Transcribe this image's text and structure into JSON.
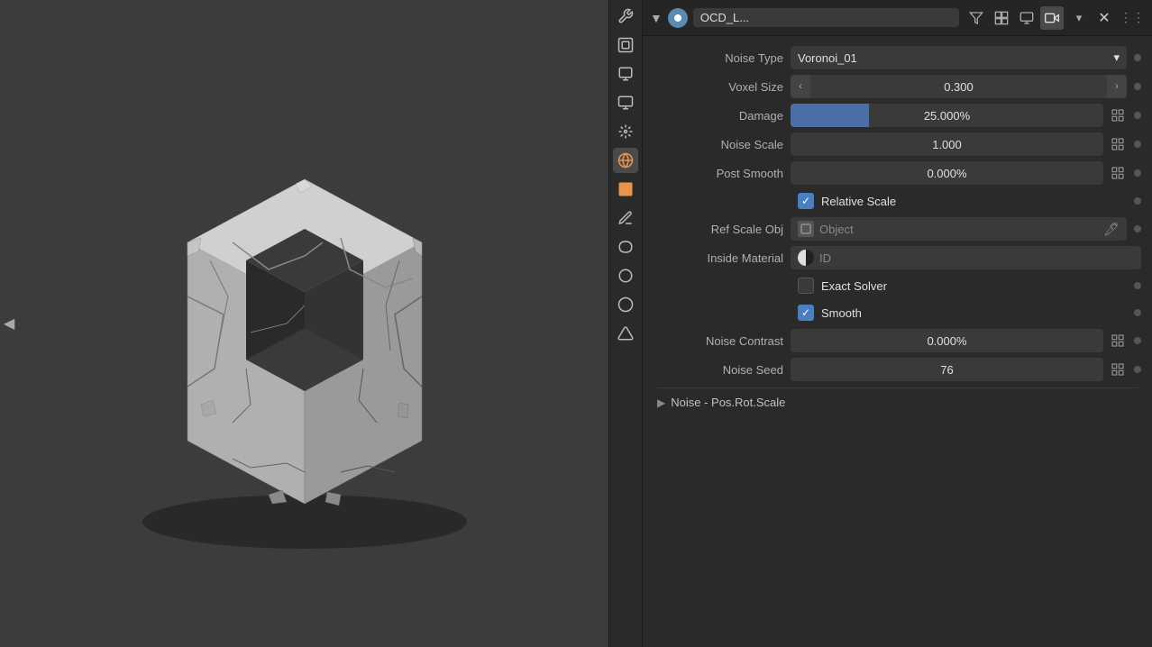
{
  "viewport": {
    "arrow_label": "◀"
  },
  "toolbar": {
    "items": [
      {
        "id": "tools",
        "icon": "🔧",
        "active": false
      },
      {
        "id": "scene",
        "icon": "🎬",
        "active": false
      },
      {
        "id": "output",
        "icon": "🖼",
        "active": false
      },
      {
        "id": "view",
        "icon": "🖥",
        "active": false
      },
      {
        "id": "particles",
        "icon": "🌊",
        "active": false
      },
      {
        "id": "physics",
        "icon": "🌐",
        "active": true
      },
      {
        "id": "object",
        "icon": "🟧",
        "active": false
      },
      {
        "id": "modifier",
        "icon": "🔩",
        "active": false
      },
      {
        "id": "curves",
        "icon": "〰",
        "active": false
      },
      {
        "id": "data",
        "icon": "🔵",
        "active": false
      },
      {
        "id": "material",
        "icon": "🔴",
        "active": false
      },
      {
        "id": "constraint",
        "icon": "🔷",
        "active": false
      }
    ]
  },
  "panel": {
    "title": "OCD_L...",
    "tabs": [
      {
        "id": "filter",
        "icon": "▽",
        "active": false
      },
      {
        "id": "select",
        "icon": "⊞",
        "active": false
      },
      {
        "id": "view",
        "icon": "🖥",
        "active": false
      },
      {
        "id": "camera",
        "icon": "📷",
        "active": true
      }
    ],
    "menu_icon": "▼",
    "close_icon": "✕",
    "dots_icon": "⋮⋮"
  },
  "properties": {
    "noise_type": {
      "label": "Noise Type",
      "value": "Voronoi_01",
      "dropdown_arrow": "▾"
    },
    "voxel_size": {
      "label": "Voxel Size",
      "value": "0.300",
      "left_arrow": "‹",
      "right_arrow": "›"
    },
    "damage": {
      "label": "Damage",
      "value": "25.000%",
      "fill_percent": 25
    },
    "noise_scale": {
      "label": "Noise Scale",
      "value": "1.000"
    },
    "post_smooth": {
      "label": "Post Smooth",
      "value": "0.000%"
    },
    "relative_scale": {
      "label": "Relative Scale",
      "checked": true
    },
    "ref_scale_obj": {
      "label": "Ref Scale Obj",
      "obj_label": "Object",
      "eyedropper": "💉"
    },
    "inside_material": {
      "label": "Inside Material",
      "mat_label": "ID"
    },
    "exact_solver": {
      "label": "Exact Solver",
      "checked": false
    },
    "smooth": {
      "label": "Smooth",
      "checked": true
    },
    "noise_contrast": {
      "label": "Noise Contrast",
      "value": "0.000%"
    },
    "noise_seed": {
      "label": "Noise Seed",
      "value": "76"
    },
    "noise_pos_rot_scale": {
      "label": "Noise - Pos.Rot.Scale",
      "arrow": "▶"
    }
  },
  "adjust_icon": "⊞",
  "checkmark": "✓"
}
